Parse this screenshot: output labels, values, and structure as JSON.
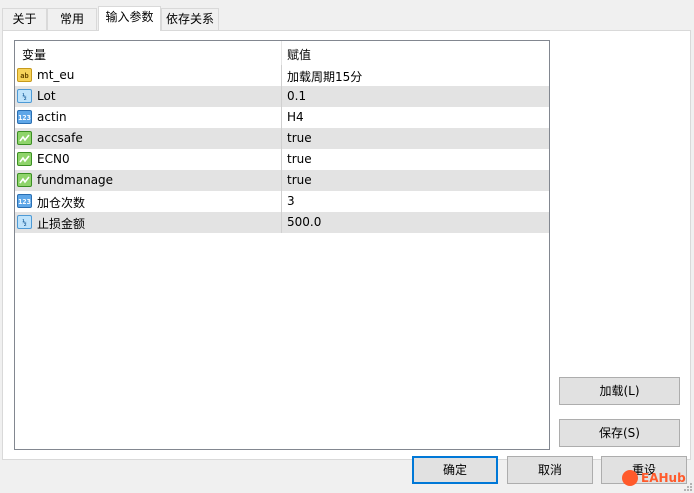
{
  "tabs": [
    "关于",
    "常用",
    "输入参数",
    "依存关系"
  ],
  "grid": {
    "header": {
      "variable": "变量",
      "value": "赋值"
    },
    "rows": [
      {
        "icon": "string-type-icon",
        "name": "mt_eu",
        "value": "加载周期15分"
      },
      {
        "icon": "double-type-icon",
        "name": "Lot",
        "value": "0.1"
      },
      {
        "icon": "int-type-icon",
        "name": "actin",
        "value": "H4"
      },
      {
        "icon": "bool-type-icon",
        "name": "accsafe",
        "value": "true"
      },
      {
        "icon": "bool-type-icon",
        "name": "ECN0",
        "value": "true"
      },
      {
        "icon": "bool-type-icon",
        "name": "fundmanage",
        "value": "true"
      },
      {
        "icon": "int-type-icon",
        "name": "加仓次数",
        "value": "3"
      },
      {
        "icon": "double-type-icon",
        "name": "止损金额",
        "value": "500.0"
      }
    ]
  },
  "icons": {
    "string_label": "ab",
    "double_label": "½",
    "int_label": "123"
  },
  "buttons": {
    "load": "加载(L)",
    "save": "保存(S)",
    "ok": "确定",
    "cancel": "取消",
    "reset": "重设"
  },
  "watermark": "EAHub",
  "colors": {
    "selected_tab_bg": "#ffffff",
    "row_alt_bg": "#e3e3e3",
    "default_button_border": "#0078d7",
    "watermark": "#ff5a2b"
  }
}
